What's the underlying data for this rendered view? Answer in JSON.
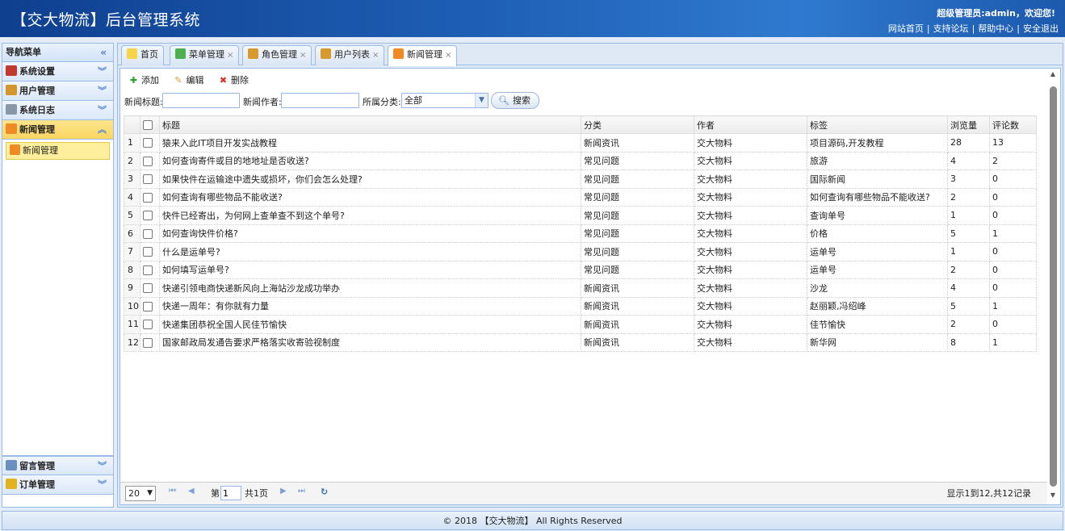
{
  "header": {
    "title": "【交大物流】后台管理系统",
    "welcome": "超级管理员:admin，欢迎您!",
    "links": [
      "网站首页",
      "支持论坛",
      "帮助中心",
      "安全退出"
    ]
  },
  "sidebar": {
    "title": "导航菜单",
    "top_items": [
      {
        "label": "系统设置",
        "icon": "tools-icon",
        "color": "#c0392b"
      },
      {
        "label": "用户管理",
        "icon": "users-icon",
        "color": "#d4962b"
      },
      {
        "label": "系统日志",
        "icon": "log-icon",
        "color": "#8a97a8"
      },
      {
        "label": "新闻管理",
        "icon": "rss-icon",
        "color": "#f08a24"
      }
    ],
    "sub_items": [
      {
        "label": "新闻管理",
        "icon": "rss-icon"
      }
    ],
    "bottom_items": [
      {
        "label": "留言管理",
        "icon": "comment-icon",
        "color": "#6b8fbf"
      },
      {
        "label": "订单管理",
        "icon": "order-icon",
        "color": "#e2b21f"
      }
    ]
  },
  "tabs": [
    {
      "label": "首页",
      "icon": "bulb-icon",
      "closable": false
    },
    {
      "label": "菜单管理",
      "icon": "sitemap-icon",
      "closable": true
    },
    {
      "label": "角色管理",
      "icon": "role-icon",
      "closable": true
    },
    {
      "label": "用户列表",
      "icon": "users-icon",
      "closable": true
    },
    {
      "label": "新闻管理",
      "icon": "rss-icon",
      "closable": true,
      "active": true
    }
  ],
  "toolbar": {
    "add": "添加",
    "edit": "编辑",
    "delete": "删除"
  },
  "search": {
    "title_label": "新闻标题:",
    "title_value": "",
    "author_label": "新闻作者:",
    "author_value": "",
    "category_label": "所属分类:",
    "category_value": "全部",
    "button": "搜索"
  },
  "table": {
    "columns": [
      "标题",
      "分类",
      "作者",
      "标签",
      "浏览量",
      "评论数"
    ],
    "rows": [
      {
        "n": "1",
        "title": "猿来入此IT项目开发实战教程",
        "cat": "新闻资讯",
        "author": "交大物料",
        "tags": "项目源码,开发教程",
        "views": "28",
        "comments": "13"
      },
      {
        "n": "2",
        "title": "如何查询寄件或目的地地址是否收送?",
        "cat": "常见问题",
        "author": "交大物料",
        "tags": "旅游",
        "views": "4",
        "comments": "2"
      },
      {
        "n": "3",
        "title": "如果快件在运输途中遗失或损坏，你们会怎么处理?",
        "cat": "常见问题",
        "author": "交大物料",
        "tags": "国际新闻",
        "views": "3",
        "comments": "0"
      },
      {
        "n": "4",
        "title": "如何查询有哪些物品不能收送?",
        "cat": "常见问题",
        "author": "交大物料",
        "tags": "如何查询有哪些物品不能收送?",
        "views": "2",
        "comments": "0"
      },
      {
        "n": "5",
        "title": "快件已经寄出，为何网上查单查不到这个单号?",
        "cat": "常见问题",
        "author": "交大物料",
        "tags": "查询单号",
        "views": "1",
        "comments": "0"
      },
      {
        "n": "6",
        "title": "如何查询快件价格?",
        "cat": "常见问题",
        "author": "交大物料",
        "tags": "价格",
        "views": "5",
        "comments": "1"
      },
      {
        "n": "7",
        "title": "什么是运单号?",
        "cat": "常见问题",
        "author": "交大物料",
        "tags": "运单号",
        "views": "1",
        "comments": "0"
      },
      {
        "n": "8",
        "title": "如何填写运单号?",
        "cat": "常见问题",
        "author": "交大物料",
        "tags": "运单号",
        "views": "2",
        "comments": "0"
      },
      {
        "n": "9",
        "title": "快递引领电商快递新风向上海站沙龙成功举办",
        "cat": "新闻资讯",
        "author": "交大物料",
        "tags": "沙龙",
        "views": "4",
        "comments": "0"
      },
      {
        "n": "10",
        "title": "快递一周年：有你就有力量",
        "cat": "新闻资讯",
        "author": "交大物料",
        "tags": "赵丽颖,冯绍峰",
        "views": "5",
        "comments": "1"
      },
      {
        "n": "11",
        "title": "快递集团恭祝全国人民佳节愉快",
        "cat": "新闻资讯",
        "author": "交大物料",
        "tags": "佳节愉快",
        "views": "2",
        "comments": "0"
      },
      {
        "n": "12",
        "title": "国家邮政局发通告要求严格落实收寄验视制度",
        "cat": "新闻资讯",
        "author": "交大物料",
        "tags": "新华网",
        "views": "8",
        "comments": "1"
      }
    ]
  },
  "pager": {
    "page_size": "20",
    "page_prefix": "第",
    "page_value": "1",
    "page_total": "共1页",
    "summary": "显示1到12,共12记录"
  },
  "footer": "© 2018 【交大物流】 All Rights Reserved"
}
